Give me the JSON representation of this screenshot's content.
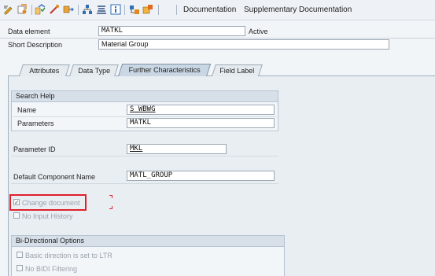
{
  "toolbar": {
    "icons": [
      "display-change-icon",
      "active-inactive-icon",
      "check-icon",
      "where-used-icon",
      "other-object-icon",
      "hierarchy-icon",
      "stack-icon",
      "info-icon",
      "object-tree-icon",
      "extras-icon"
    ],
    "documentation": "Documentation",
    "supplementary_documentation": "Supplementary Documentation"
  },
  "header": {
    "data_element_label": "Data element",
    "data_element_value": "MATKL",
    "status": "Active",
    "short_description_label": "Short Description",
    "short_description_value": "Material Group"
  },
  "tabs": [
    {
      "label": "Attributes",
      "active": false
    },
    {
      "label": "Data Type",
      "active": false
    },
    {
      "label": "Further Characteristics",
      "active": true
    },
    {
      "label": "Field Label",
      "active": false
    }
  ],
  "search_help": {
    "title": "Search Help",
    "name_label": "Name",
    "name_value": "S_WBWG",
    "parameters_label": "Parameters",
    "parameters_value": "MATKL"
  },
  "parameter_id": {
    "label": "Parameter ID",
    "value": "MKL"
  },
  "default_component": {
    "label": "Default Component Name",
    "value": "MATL_GROUP"
  },
  "checkboxes": {
    "change_document": {
      "label": "Change document",
      "checked": true
    },
    "no_input_history": {
      "label": "No Input History",
      "checked": false
    }
  },
  "bidi": {
    "title": "Bi-Directional Options",
    "basic_direction": {
      "label": "Basic direction is set to LTR",
      "checked": false
    },
    "no_bidi_filtering": {
      "label": "No BIDI Filtering",
      "checked": false
    }
  },
  "colors": {
    "highlight": "#e0202c",
    "toolbar_icon_orange": "#e08a1e",
    "toolbar_icon_blue": "#2f6db5"
  }
}
